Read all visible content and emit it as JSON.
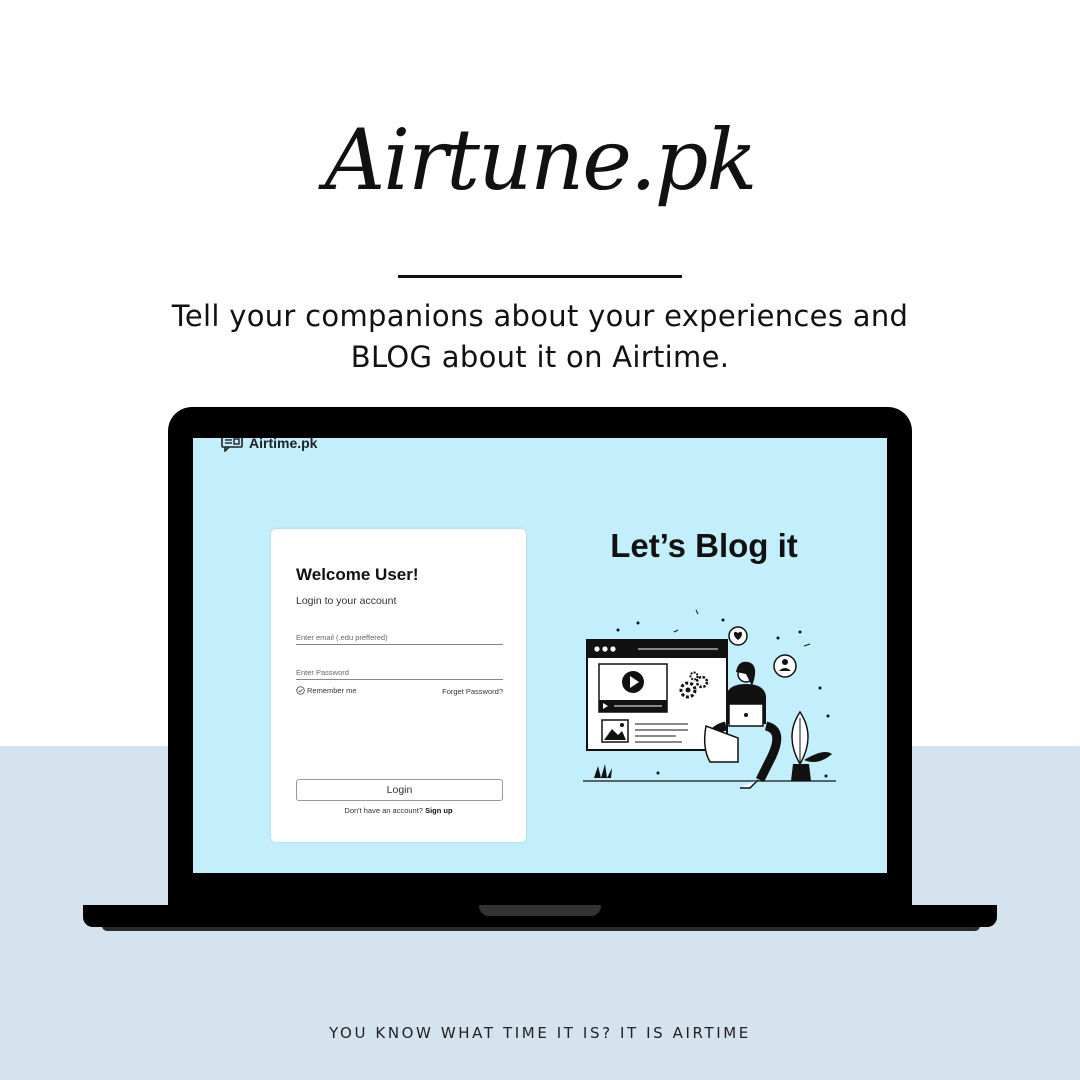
{
  "poster": {
    "logo_text": "Airtune.pk",
    "tagline_line1": "Tell your companions about your experiences and",
    "tagline_line2": "BLOG about it on Airtime.",
    "footer": "YOU KNOW WHAT TIME IT IS? IT IS AIRTIME"
  },
  "app": {
    "brand_name": "Airtime.pk",
    "brand_icon": "chat-bubble-icon"
  },
  "login": {
    "heading": "Welcome User!",
    "subtitle": "Login to your account",
    "email_placeholder": "Enter email (.edu preffered)",
    "email_value": "",
    "password_placeholder": "Enter Password",
    "password_value": "",
    "remember_label": "Remember me",
    "remember_checked": false,
    "forgot_label": "Forget Password?",
    "login_button": "Login",
    "signup_prompt": "Don't have an account?",
    "signup_link": "Sign up"
  },
  "hero": {
    "title": "Let’s Blog it",
    "illustration": "woman-blogging-with-laptop-illustration"
  },
  "colors": {
    "screen_background": "#c3effd",
    "bottom_band": "#d5e3ef",
    "page_background": "#ffffff",
    "ink": "#111111"
  }
}
